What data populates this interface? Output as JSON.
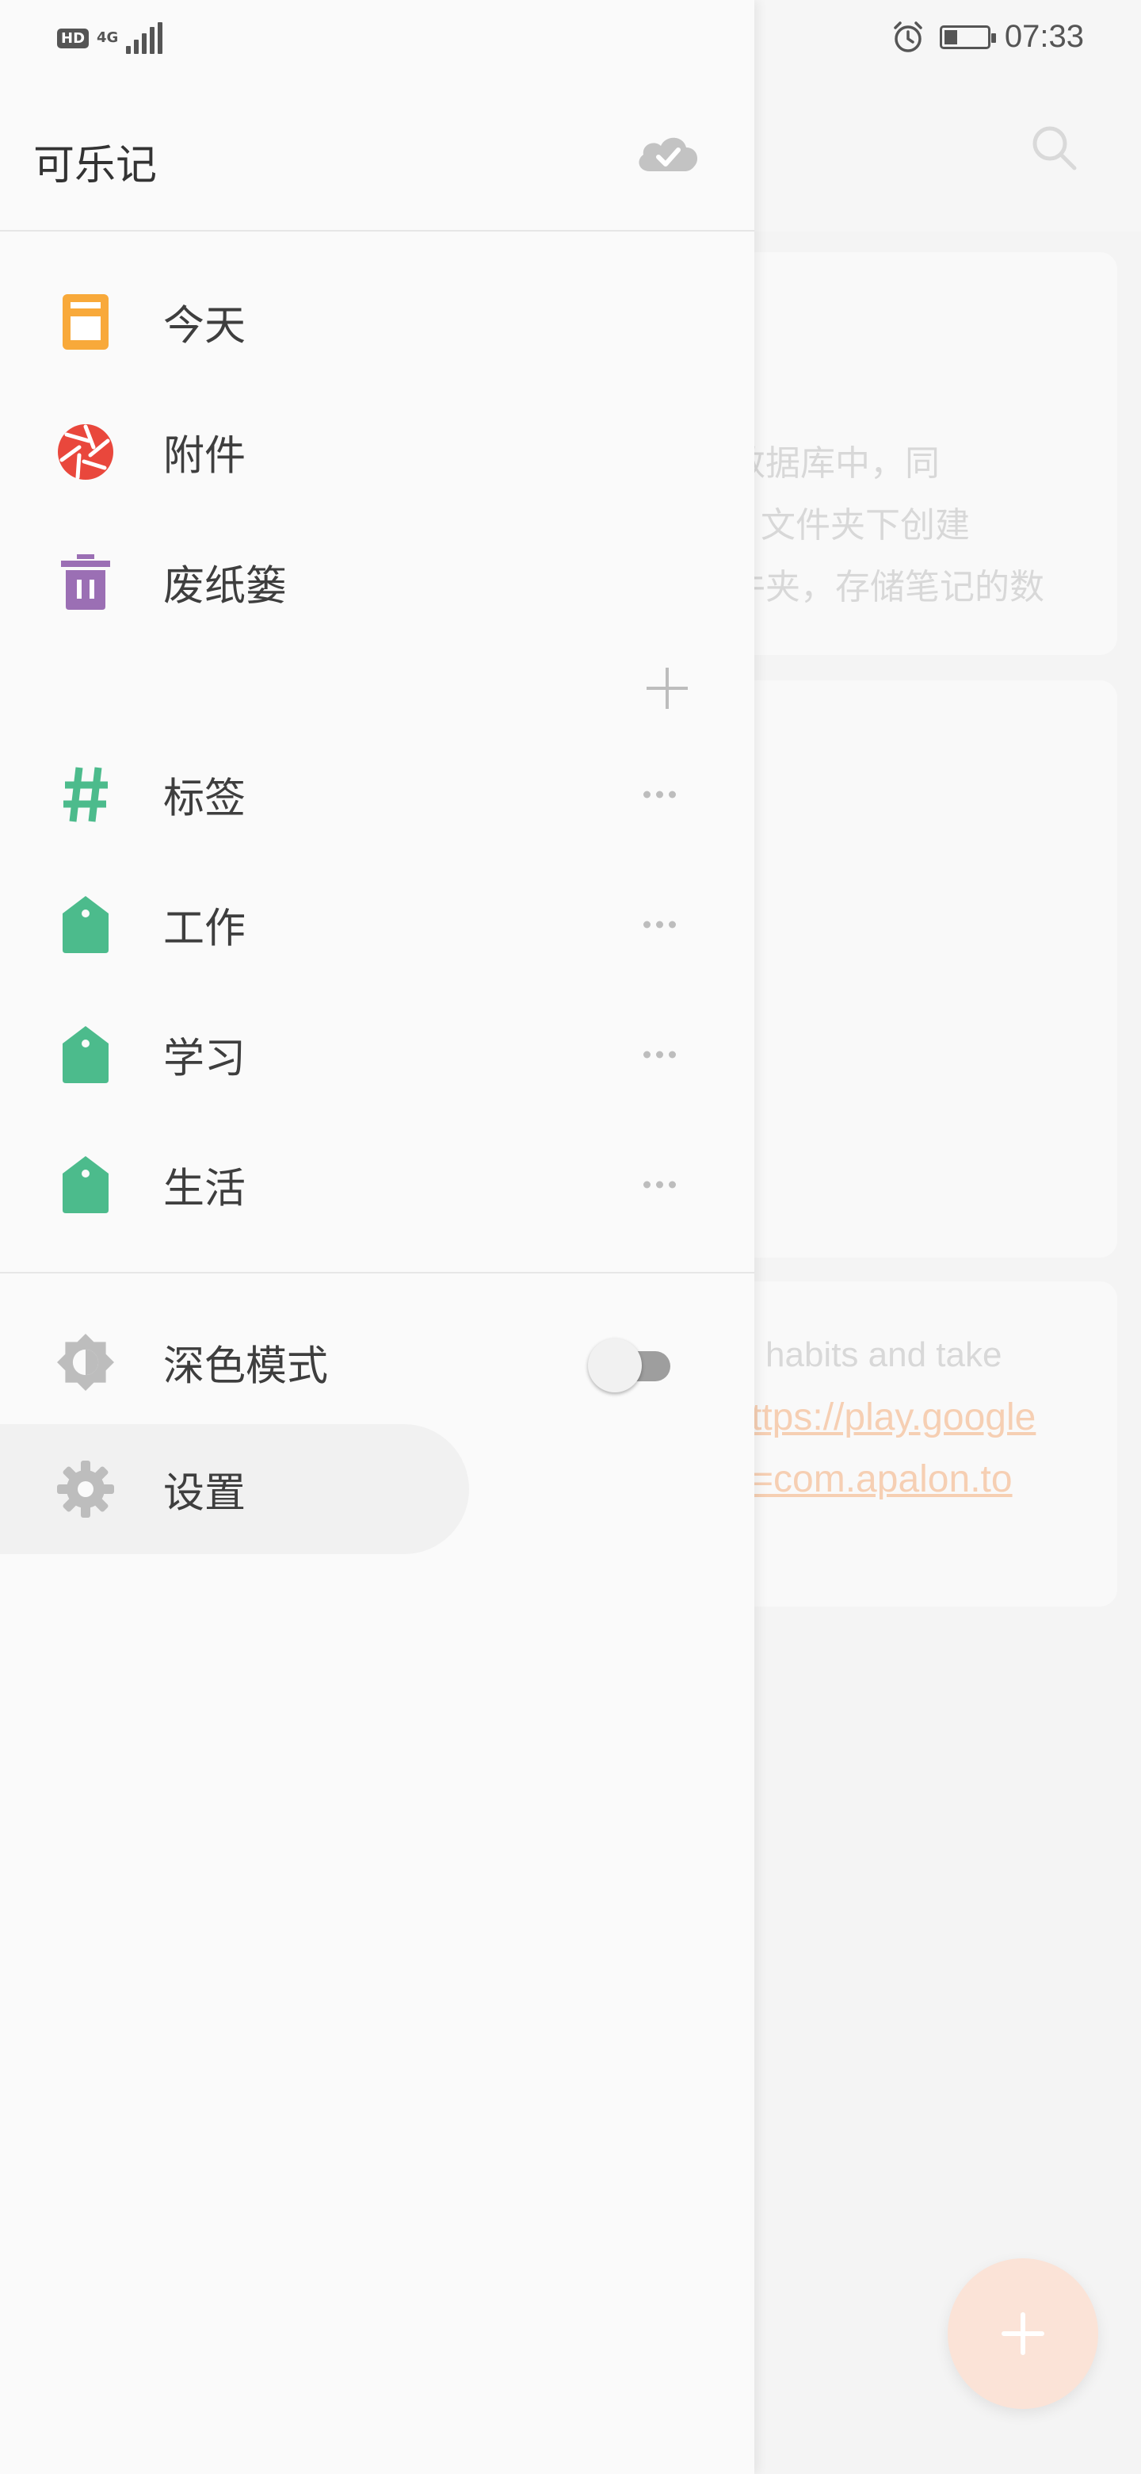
{
  "status_bar": {
    "hd": "HD",
    "network": "4G",
    "time": "07:33",
    "icons": [
      "hd-icon",
      "signal-icon",
      "alarm-icon",
      "battery-icon"
    ]
  },
  "background": {
    "note1_lines": [
      "数据库中，同",
      "文件夹下创建",
      "件夹，存储笔记的数"
    ],
    "note3_text": "habits and take",
    "note3_links": [
      "ttps://play.google",
      "=com.apalon.to"
    ],
    "icons": [
      "search-icon",
      "add-icon"
    ]
  },
  "drawer": {
    "title": "可乐记",
    "sync_icon": "cloud-check-icon",
    "nav": [
      {
        "label": "今天",
        "icon": "today-icon",
        "color": "#F8A93A"
      },
      {
        "label": "附件",
        "icon": "aperture-icon",
        "color": "#E9473C"
      },
      {
        "label": "废纸篓",
        "icon": "trash-icon",
        "color": "#9B6FB4"
      }
    ],
    "tags_header": {
      "label": "标签",
      "icon": "hash-icon",
      "color": "#4CBB8C"
    },
    "tags": [
      {
        "label": "工作",
        "icon": "tag-icon",
        "color": "#4CBB8C"
      },
      {
        "label": "学习",
        "icon": "tag-icon",
        "color": "#4CBB8C"
      },
      {
        "label": "生活",
        "icon": "tag-icon",
        "color": "#4CBB8C"
      }
    ],
    "dark_mode": {
      "label": "深色模式",
      "icon": "brightness-icon",
      "enabled": false
    },
    "settings": {
      "label": "设置",
      "icon": "gear-icon"
    }
  }
}
